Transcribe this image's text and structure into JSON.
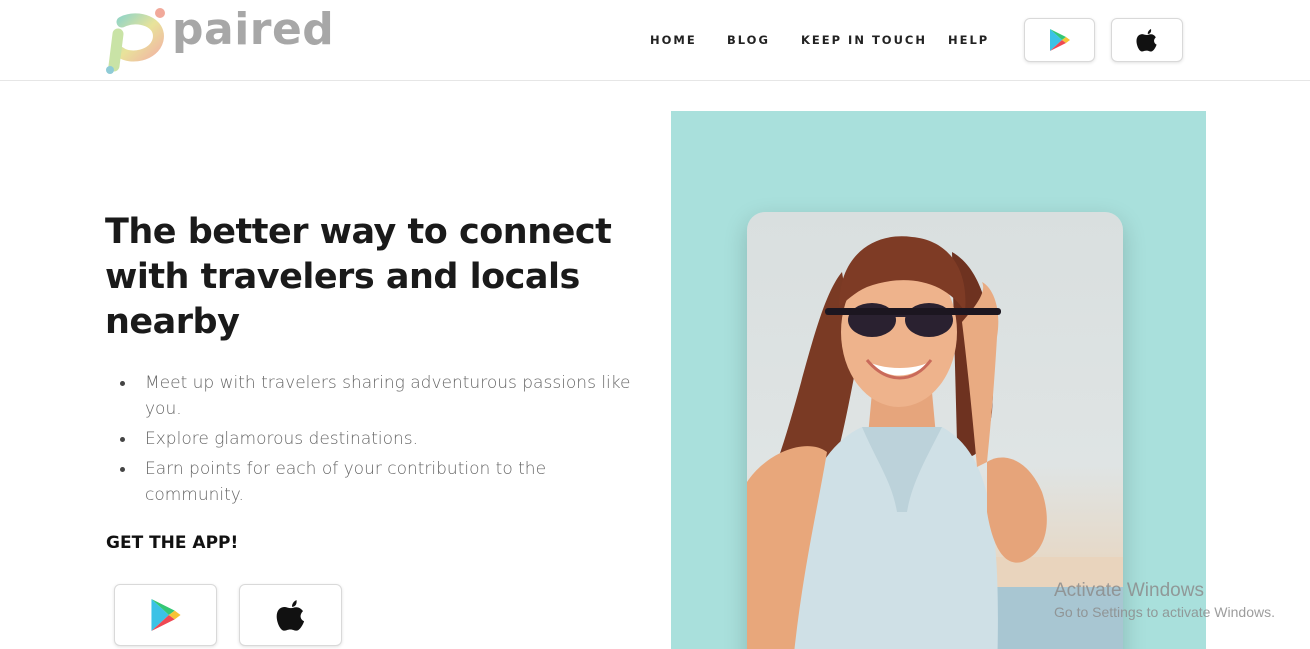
{
  "brand": {
    "name": "paired"
  },
  "nav": {
    "items": [
      {
        "label": "HOME"
      },
      {
        "label": "BLOG"
      },
      {
        "label": "KEEP IN TOUCH"
      },
      {
        "label": "HELP"
      }
    ],
    "store_buttons": [
      {
        "icon": "google-play-icon"
      },
      {
        "icon": "apple-icon"
      }
    ]
  },
  "hero": {
    "headline": "The better way to connect with travelers and locals nearby",
    "features": [
      "Meet up with travelers sharing adventurous passions like you.",
      "Explore glamorous destinations.",
      "Earn points for each of your contribution to the community."
    ],
    "cta_label": "GET THE APP!",
    "store_buttons": [
      {
        "icon": "google-play-icon"
      },
      {
        "icon": "apple-icon"
      }
    ],
    "image": "woman-with-sunglasses-photo"
  },
  "overlay": {
    "title": "Activate Windows",
    "subtitle": "Go to Settings to activate Windows."
  },
  "colors": {
    "hero_bg": "#a9e0dc",
    "logo_gray": "#a7a7a7",
    "text_dark": "#1a1a1a",
    "text_muted": "#666666"
  }
}
